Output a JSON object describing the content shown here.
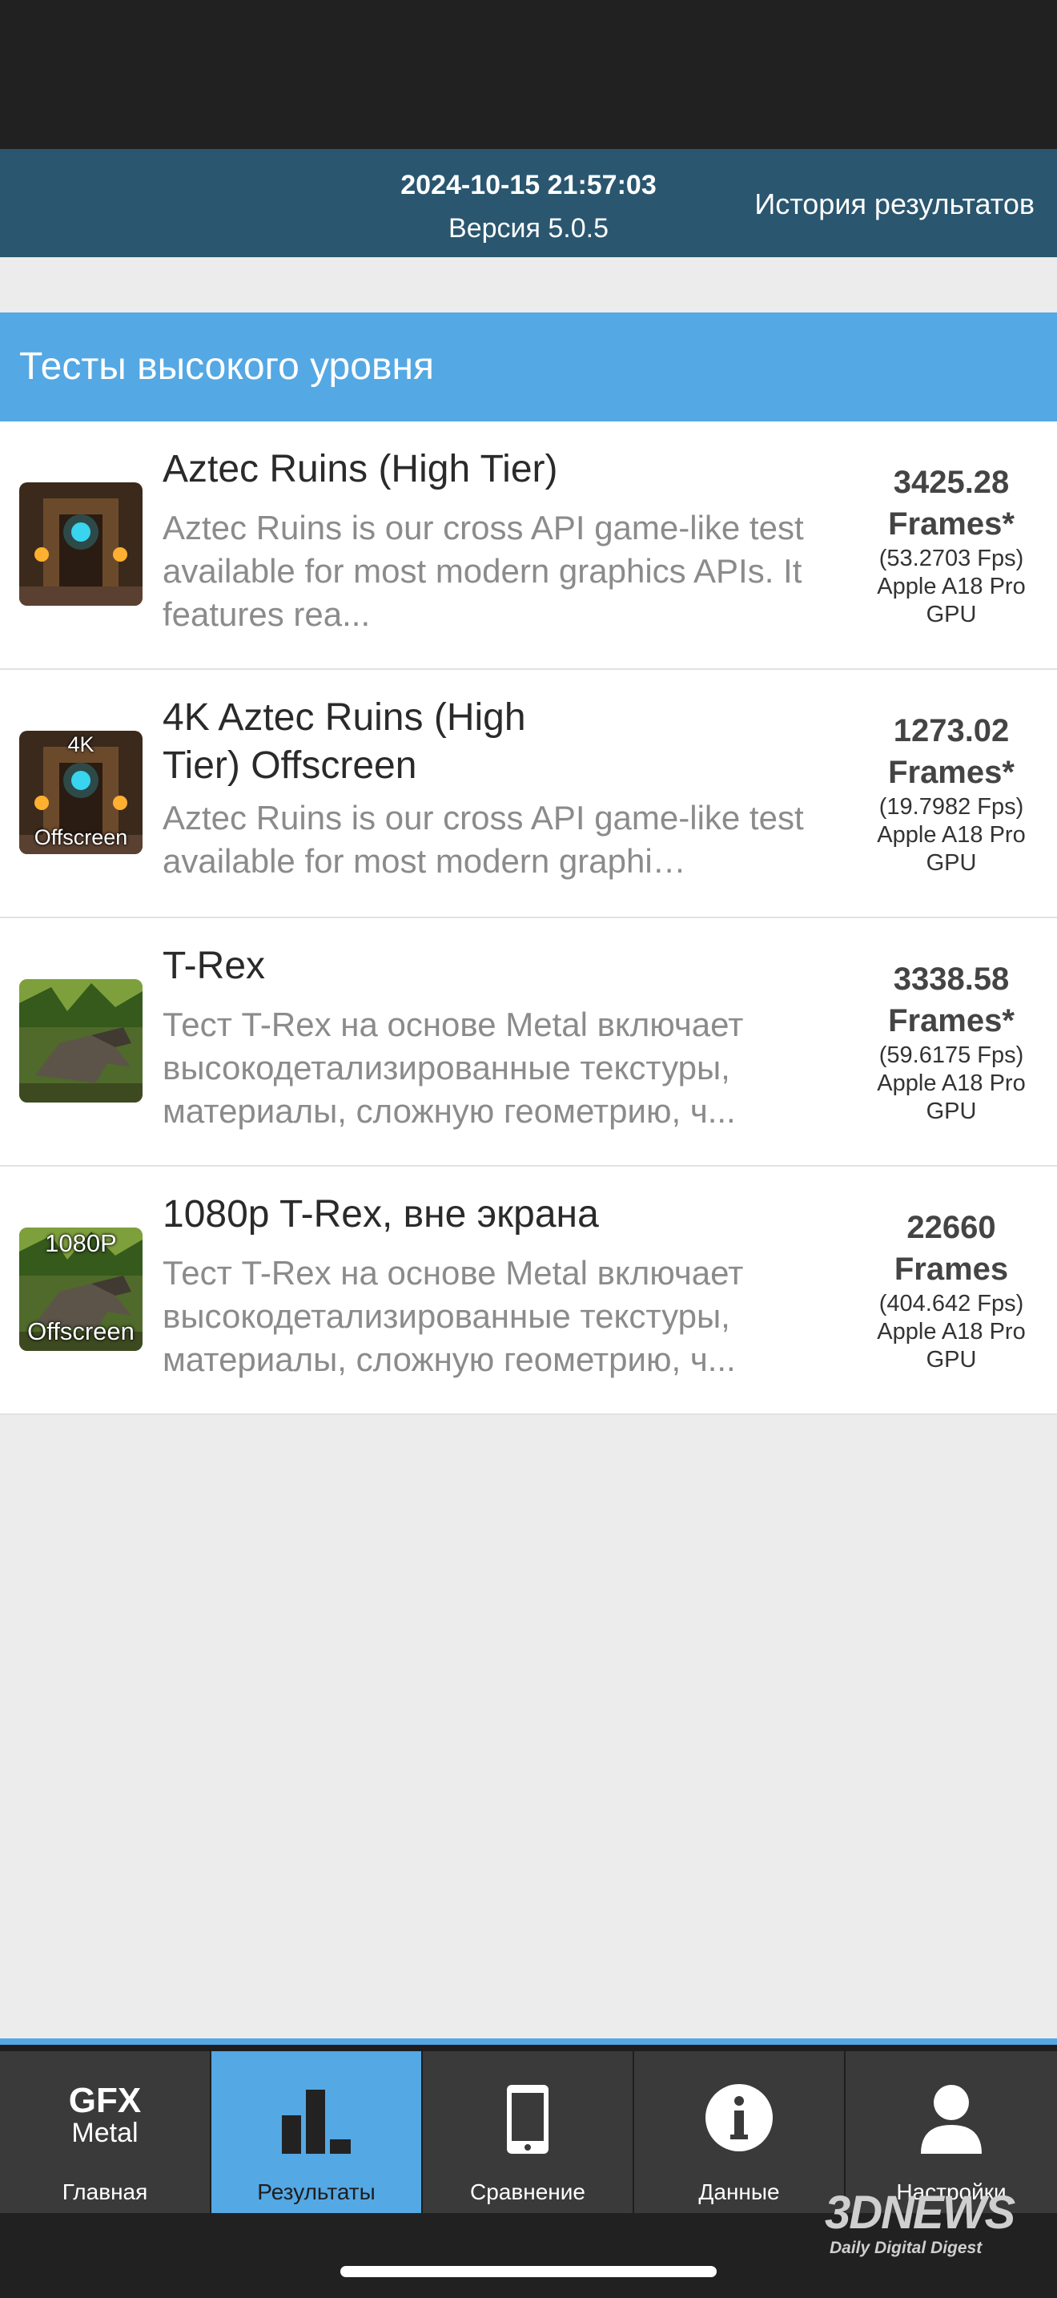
{
  "header": {
    "date": "2024-10-15 21:57:03",
    "version": "Версия 5.0.5",
    "history_label": "История результатов"
  },
  "section": {
    "title": "Тесты высокого уровня"
  },
  "tests": [
    {
      "title": "Aztec Ruins (High Tier)",
      "description": "Aztec Ruins is our cross API game-like test available for most modern graphics APIs. It features rea...",
      "value": "3425.28",
      "unit": "Frames*",
      "fps": "(53.2703 Fps)",
      "gpu": "Apple A18 Pro GPU",
      "thumb_top": "",
      "thumb_bottom": ""
    },
    {
      "title": "4K Aztec Ruins (High Tier) Offscreen",
      "description": "Aztec Ruins is our cross API game-like test available for most modern graphi…",
      "value": "1273.02",
      "unit": "Frames*",
      "fps": "(19.7982 Fps)",
      "gpu": "Apple A18 Pro GPU",
      "thumb_top": "4K",
      "thumb_bottom": "Offscreen"
    },
    {
      "title": "T-Rex",
      "description": "Тест T-Rex на основе Metal включает высокодетализированные текстуры, материалы, сложную геометрию, ч...",
      "value": "3338.58",
      "unit": "Frames*",
      "fps": "(59.6175 Fps)",
      "gpu": "Apple A18 Pro GPU",
      "thumb_top": "",
      "thumb_bottom": ""
    },
    {
      "title": "1080p T-Rex, вне экрана",
      "description": "Тест T-Rex на основе Metal включает высокодетализированные текстуры, материалы, сложную геометрию, ч...",
      "value": "22660",
      "unit": "Frames",
      "fps": "(404.642 Fps)",
      "gpu": "Apple A18 Pro GPU",
      "thumb_top": "1080P",
      "thumb_bottom": "Offscreen"
    }
  ],
  "nav": {
    "home": "Главная",
    "results": "Результаты",
    "compare": "Сравнение",
    "info": "Данные",
    "settings": "Настройки",
    "logo_line1": "GFX",
    "logo_line2": "Metal"
  },
  "watermark": {
    "line1": "3DNEWS",
    "line2": "Daily Digital Digest"
  },
  "colors": {
    "header": "#2a566f",
    "accent": "#54a8e4",
    "nav_bg": "#3a3a3a"
  }
}
